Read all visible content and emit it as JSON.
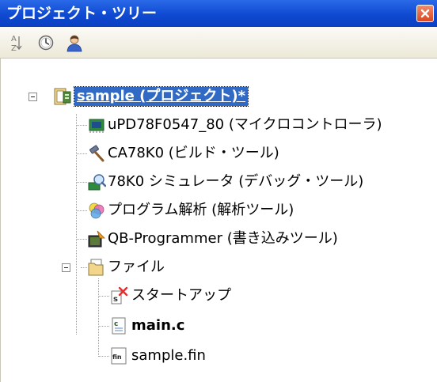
{
  "panel": {
    "title": "プロジェクト・ツリー",
    "close_icon": "close-icon"
  },
  "toolbar": {
    "buttons": [
      {
        "name": "sort-az-icon"
      },
      {
        "name": "clock-icon"
      },
      {
        "name": "user-icon"
      }
    ]
  },
  "tree": {
    "root": {
      "label": "sample (プロジェクト)*",
      "icon": "project-icon"
    },
    "items": [
      {
        "label": "uPD78F0547_80 (マイクロコントローラ)",
        "icon": "microcontroller-icon"
      },
      {
        "label": "CA78K0 (ビルド・ツール)",
        "icon": "hammer-icon"
      },
      {
        "label": "78K0 シミュレータ (デバッグ・ツール)",
        "icon": "simulator-icon"
      },
      {
        "label": "プログラム解析 (解析ツール)",
        "icon": "analysis-icon"
      },
      {
        "label": "QB-Programmer (書き込みツール)",
        "icon": "programmer-icon"
      }
    ],
    "folder": {
      "label": "ファイル",
      "icon": "file-folder-icon",
      "children": [
        {
          "label": "スタートアップ",
          "icon": "startup-icon"
        },
        {
          "label": "main.c",
          "icon": "c-file-icon"
        },
        {
          "label": "sample.fin",
          "icon": "fin-file-icon"
        }
      ]
    }
  },
  "colors": {
    "titlebar": "#0f4ad1",
    "selection": "#316ac5",
    "toolbar": "#ece9d8"
  }
}
